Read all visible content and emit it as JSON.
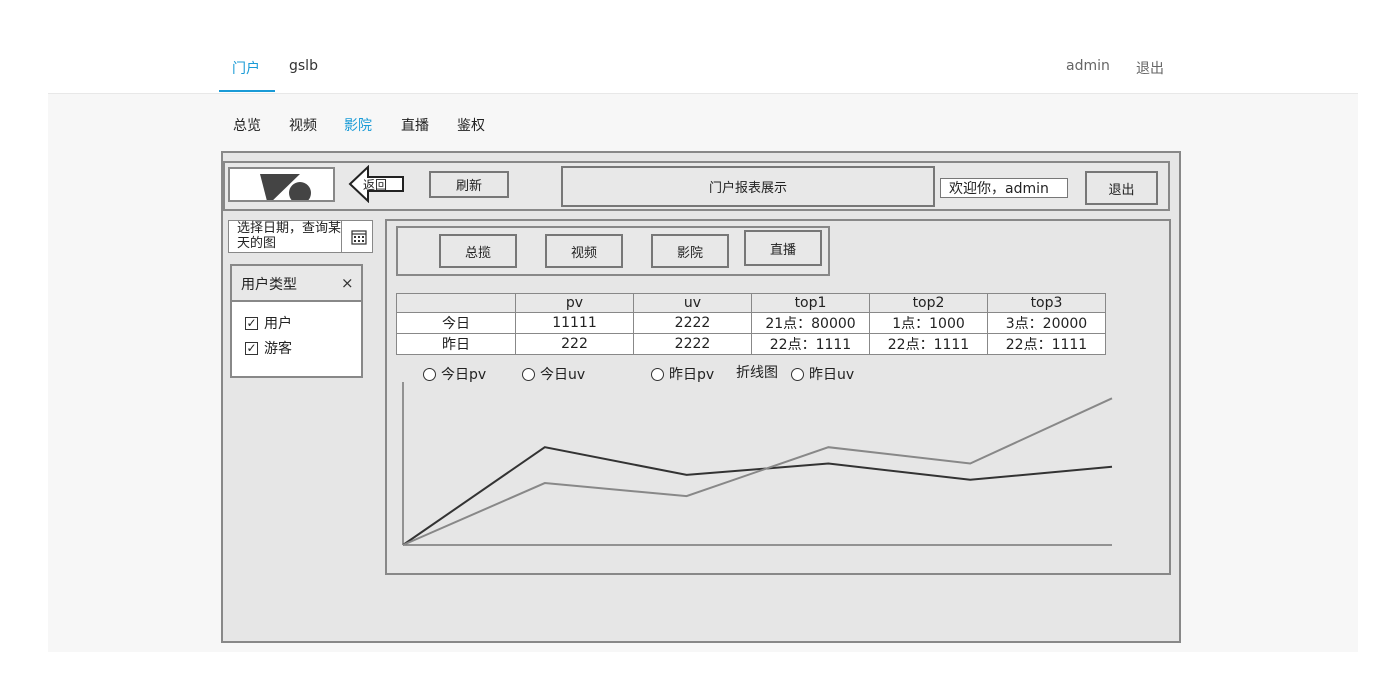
{
  "topnav": {
    "tabs": [
      {
        "label": "门户",
        "active": true
      },
      {
        "label": "gslb",
        "active": false
      }
    ],
    "user": "admin",
    "logout": "退出"
  },
  "subnav": {
    "items": [
      {
        "label": "总览",
        "active": false
      },
      {
        "label": "视频",
        "active": false
      },
      {
        "label": "影院",
        "active": true
      },
      {
        "label": "直播",
        "active": false
      },
      {
        "label": "鉴权",
        "active": false
      }
    ]
  },
  "header": {
    "back_label": "返回",
    "refresh_label": "刷新",
    "title": "门户报表展示",
    "welcome": "欢迎你，admin",
    "logout_label": "退出"
  },
  "sidebar": {
    "date_placeholder": "选择日期，查询某天的图",
    "filter_title": "用户类型",
    "close_glyph": "×",
    "options": [
      {
        "label": "用户",
        "checked": true
      },
      {
        "label": "游客",
        "checked": true
      }
    ]
  },
  "tabs": [
    "总揽",
    "视频",
    "影院",
    "直播"
  ],
  "table": {
    "columns": [
      "",
      "pv",
      "uv",
      "top1",
      "top2",
      "top3"
    ],
    "rows": [
      [
        "今日",
        "11111",
        "2222",
        "21点：80000",
        "1点：1000",
        "3点：20000"
      ],
      [
        "昨日",
        "222",
        "2222",
        "22点：1111",
        "22点：1111",
        "22点：1111"
      ]
    ]
  },
  "radios": [
    {
      "label": "今日pv"
    },
    {
      "label": "今日uv"
    },
    {
      "label": "昨日pv"
    },
    {
      "label": "昨日uv"
    }
  ],
  "chart_caption": "折线图",
  "colors": {
    "accent": "#1a9bd7",
    "wire_border": "#888888",
    "line_dark": "#333333",
    "line_light": "#888888"
  },
  "chart_data": {
    "type": "line",
    "x": [
      0,
      1,
      2,
      3,
      4,
      5
    ],
    "series": [
      {
        "values": [
          0,
          60,
          43,
          50,
          40,
          48
        ]
      },
      {
        "values": [
          0,
          38,
          30,
          60,
          50,
          90
        ]
      }
    ],
    "ylim": [
      0,
      100
    ],
    "grid": false
  }
}
